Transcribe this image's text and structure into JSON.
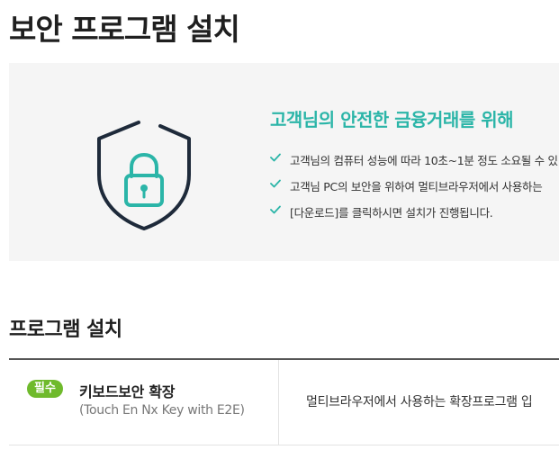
{
  "page": {
    "title": "보안 프로그램 설치"
  },
  "intro": {
    "heading": "고객님의 안전한 금융거래를 위해",
    "items": [
      {
        "text": "고객님의 컴퓨터 성능에 따라 10초~1분 정도 소요될 수 있"
      },
      {
        "text": "고객님 PC의 보안을 위하여 멀티브라우저에서 사용하는"
      },
      {
        "text": "[다운로드]를 클릭하시면 설치가 진행됩니다."
      }
    ],
    "icons": {
      "shield": "shield-lock-icon",
      "check": "checkmark-icon"
    }
  },
  "programs": {
    "section_title": "프로그램 설치",
    "rows": [
      {
        "badge": "필수",
        "name": "키보드보안 확장",
        "subname": "(Touch En Nx Key with E2E)",
        "description": "멀티브라우저에서 사용하는 확장프로그램 입"
      }
    ]
  },
  "colors": {
    "accent": "#2bb5a8",
    "badge": "#6fba2c",
    "shield_outline": "#1e2a3a",
    "panel_bg": "#f5f5f5"
  }
}
